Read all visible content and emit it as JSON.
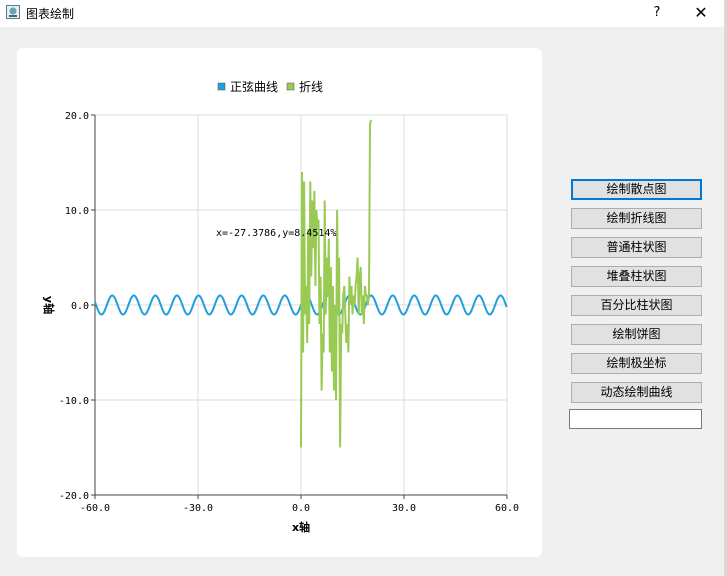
{
  "window": {
    "title": "图表绘制",
    "help_label": "?",
    "close_label": "✕",
    "icon": "app-chart-icon"
  },
  "buttons": [
    {
      "label": "绘制散点图",
      "active": true
    },
    {
      "label": "绘制折线图",
      "active": false
    },
    {
      "label": "普通柱状图",
      "active": false
    },
    {
      "label": "堆叠柱状图",
      "active": false
    },
    {
      "label": "百分比柱状图",
      "active": false
    },
    {
      "label": "绘制饼图",
      "active": false
    },
    {
      "label": "绘制极坐标",
      "active": false
    },
    {
      "label": "动态绘制曲线",
      "active": false
    }
  ],
  "input": {
    "value": "",
    "placeholder": ""
  },
  "chart_data": {
    "type": "line",
    "title": "",
    "xlabel": "x轴",
    "ylabel": "y轴",
    "xlim": [
      -60,
      60
    ],
    "ylim": [
      -20,
      20
    ],
    "x_ticks": [
      "-60.0",
      "-30.0",
      "0.0",
      "30.0",
      "60.0"
    ],
    "y_ticks": [
      "20.0",
      "10.0",
      "0.0",
      "-10.0",
      "-20.0"
    ],
    "grid": true,
    "legend_position": "top-center",
    "annotation": "x=-27.3786,y=8.4514%",
    "series": [
      {
        "name": "正弦曲线",
        "color": "#209fdf",
        "function": "sin",
        "x_range": [
          -60,
          60
        ]
      },
      {
        "name": "折线",
        "color": "#99ca53",
        "x": [
          0,
          0.3,
          0.6,
          0.9,
          1.2,
          1.5,
          1.8,
          2.1,
          2.4,
          2.7,
          3.0,
          3.3,
          3.6,
          3.9,
          4.2,
          4.5,
          4.8,
          5.1,
          5.4,
          5.7,
          6.0,
          6.3,
          6.6,
          6.9,
          7.2,
          7.5,
          7.8,
          8.1,
          8.4,
          8.7,
          9.0,
          9.3,
          9.6,
          9.9,
          10.2,
          10.5,
          10.8,
          11.1,
          11.4,
          11.7,
          12.0,
          12.3,
          12.6,
          12.9,
          13.2,
          13.5,
          13.8,
          14.1,
          14.4,
          14.7,
          15.0,
          15.3,
          15.6,
          15.9,
          16.2,
          16.5,
          16.8,
          17.1,
          17.4,
          17.7,
          18.0,
          18.3,
          18.6,
          18.9,
          19.2,
          19.5,
          19.8,
          20.1,
          20.4
        ],
        "y": [
          -15,
          14,
          -5,
          13,
          -1,
          2,
          -4,
          8,
          -2,
          13,
          3,
          11,
          6,
          12,
          2,
          10,
          8,
          9,
          -2,
          3,
          -9,
          -3,
          -5,
          11,
          -1,
          5,
          1,
          7,
          -5,
          4,
          -7,
          2,
          -9,
          0,
          -10,
          10,
          -1,
          5,
          -15,
          -2,
          -3,
          1,
          2,
          -1,
          -4,
          -2,
          -5,
          3,
          0,
          2,
          -1,
          1,
          0,
          2,
          3,
          5,
          -1,
          3,
          4,
          -1,
          1,
          -2,
          2,
          1,
          1,
          0,
          1,
          19,
          19.5
        ]
      }
    ]
  }
}
